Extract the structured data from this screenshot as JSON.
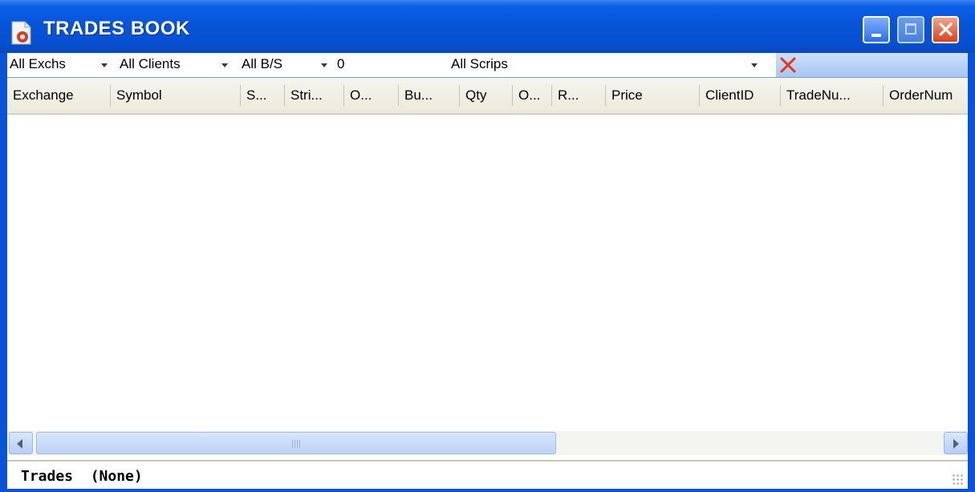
{
  "window": {
    "title": "TRADES BOOK",
    "icon": "document-gear-icon",
    "controls": [
      "minimize",
      "maximize",
      "close"
    ]
  },
  "filters": {
    "exchange": "All Exchs",
    "clients": "All Clients",
    "buy_sell": "All B/S",
    "quantity": "0",
    "scrips": "All Scrips",
    "clear_icon": "clear-x-icon"
  },
  "columns": [
    "Exchange",
    "Symbol",
    "S...",
    "Stri...",
    "O...",
    "Bu...",
    "Qty",
    "O...",
    "R...",
    "Price",
    "ClientID",
    "TradeNu...",
    "OrderNum"
  ],
  "rows": [],
  "scrollbar": {
    "thumb_fraction": 0.56
  },
  "status": {
    "text": "Trades  (None)"
  },
  "colors": {
    "titlebar": "#0754d8",
    "close": "#d7421c",
    "clear_icon": "#e8341a"
  }
}
